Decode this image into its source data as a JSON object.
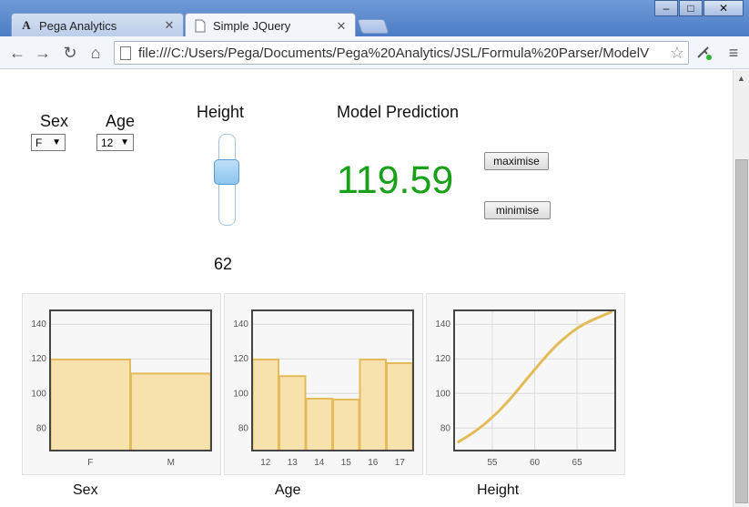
{
  "browser": {
    "tabs": [
      {
        "title": "Pega Analytics",
        "icon": "A",
        "active": false
      },
      {
        "title": "Simple JQuery",
        "icon": "page-icon",
        "active": true
      }
    ],
    "address": "file:///C:/Users/Pega/Documents/Pega%20Analytics/JSL/Formula%20Parser/ModelV",
    "window_buttons": {
      "minimize": "–",
      "maximize": "□",
      "close": "✕"
    },
    "nav": {
      "back": "←",
      "forward": "→",
      "reload": "↻",
      "home": "⌂",
      "menu": "≡",
      "star": "☆"
    }
  },
  "form": {
    "sex_label": "Sex",
    "sex_value": "F",
    "age_label": "Age",
    "age_value": "12",
    "height_label": "Height",
    "height_value": "62",
    "height_slider_fraction": 0.39,
    "prediction_label": "Model Prediction",
    "prediction_value": "119.59",
    "maximise_label": "maximise",
    "minimise_label": "minimise"
  },
  "colors": {
    "prediction": "#18a018",
    "bar_fill": "#f7e2ad",
    "bar_stroke": "#e3bb58",
    "frame": "#444444"
  },
  "chart_data": [
    {
      "type": "bar",
      "categories": [
        "F",
        "M"
      ],
      "values": [
        119.6,
        111.5
      ],
      "ylim": [
        67,
        148
      ],
      "yticks": [
        80,
        100,
        120,
        140
      ],
      "grid": true,
      "caption": "Sex"
    },
    {
      "type": "bar",
      "categories": [
        "12",
        "13",
        "14",
        "15",
        "16",
        "17"
      ],
      "values": [
        119.6,
        110,
        97,
        96.5,
        119.6,
        117.5
      ],
      "ylim": [
        67,
        148
      ],
      "yticks": [
        80,
        100,
        120,
        140
      ],
      "grid": true,
      "caption": "Age"
    },
    {
      "type": "line",
      "x": [
        51,
        53,
        55,
        57,
        59,
        61,
        62,
        63,
        65,
        67,
        69
      ],
      "y": [
        72,
        78,
        86,
        96,
        108,
        119.6,
        125,
        130,
        138,
        143,
        147
      ],
      "xlim": [
        50.5,
        69.5
      ],
      "xticks": [
        55,
        60,
        65
      ],
      "ylim": [
        67,
        148
      ],
      "yticks": [
        80,
        100,
        120,
        140
      ],
      "grid": true,
      "caption": "Height"
    }
  ]
}
